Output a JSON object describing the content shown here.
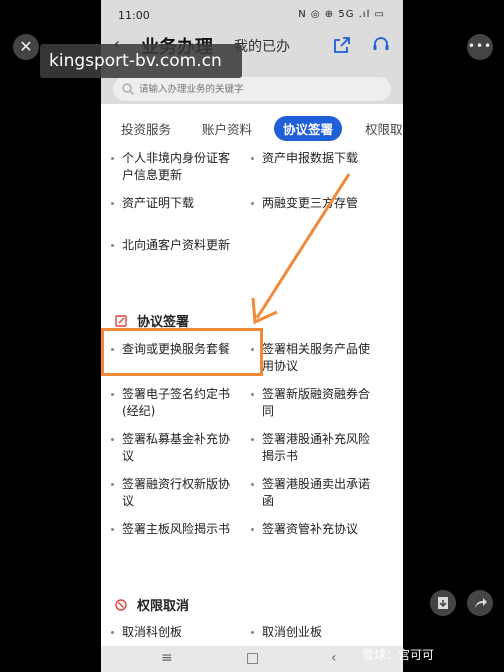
{
  "status_bar": {
    "time": "11:00",
    "indicators": "N ◎ ⊕ 5G .ıl ▭"
  },
  "header": {
    "back_icon": "chevron-left-icon",
    "title": "业务办理",
    "subtitle": "我的已办",
    "share_icon": "share-icon",
    "service_icon": "headset-icon"
  },
  "search": {
    "placeholder": "请输入办理业务的关键字"
  },
  "tabs": [
    {
      "label": "投资服务"
    },
    {
      "label": "账户资料"
    },
    {
      "label": "协议签署"
    },
    {
      "label": "权限取"
    }
  ],
  "account_items": {
    "l0a": "个人非境内身份证客",
    "l0b": "户信息更新",
    "r0": "资产申报数据下载",
    "l1": "资产证明下载",
    "r1": "两融变更三方存管",
    "l2": "北向通客户资料更新"
  },
  "agreement_section": {
    "title": "协议签署",
    "items": {
      "l0": "查询或更换服务套餐",
      "r0a": "签署相关服务产品使",
      "r0b": "用协议",
      "l1a": "签署电子签名约定书",
      "l1b": "(经纪)",
      "r1a": "签署新版融资融券合",
      "r1b": "同",
      "l2a": "签署私募基金补充协",
      "l2b": "议",
      "r2a": "签署港股通补充风险",
      "r2b": "揭示书",
      "l3a": "签署融资行权新版协",
      "l3b": "议",
      "r3a": "签署港股通卖出承诺",
      "r3b": "函",
      "l4": "签署主板风险揭示书",
      "r4": "签署资管补充协议"
    }
  },
  "permission_section": {
    "title": "权限取消",
    "items": {
      "l0": "取消科创板",
      "r0": "取消创业板"
    }
  },
  "overlay": {
    "url": "kingsport-bv.com.cn",
    "watermark": "雪球：宫可可",
    "highlight_color": "#f0893a"
  },
  "colors": {
    "accent": "#1f5fd8",
    "section_icon": "#e0443a"
  }
}
